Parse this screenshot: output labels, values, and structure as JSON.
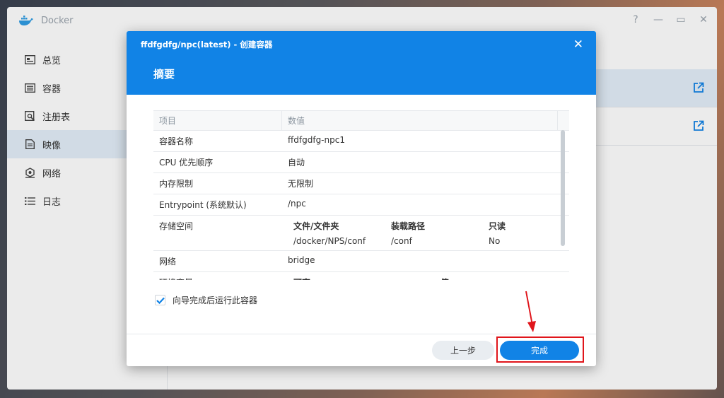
{
  "app": {
    "title": "Docker",
    "window_controls": [
      "?",
      "—",
      "▭",
      "✕"
    ]
  },
  "sidebar": {
    "items": [
      {
        "label": "总览",
        "icon": "overview-icon",
        "active": false
      },
      {
        "label": "容器",
        "icon": "container-icon",
        "active": false
      },
      {
        "label": "注册表",
        "icon": "registry-icon",
        "active": false
      },
      {
        "label": "映像",
        "icon": "image-icon",
        "active": true
      },
      {
        "label": "网络",
        "icon": "network-icon",
        "active": false
      },
      {
        "label": "日志",
        "icon": "log-icon",
        "active": false
      }
    ]
  },
  "dialog": {
    "title": "ffdfgdfg/npc(latest) - 创建容器",
    "heading": "摘要",
    "close": "✕",
    "table": {
      "headers": [
        "项目",
        "数值"
      ],
      "rows": [
        {
          "item": "容器名称",
          "value": "ffdfgdfg-npc1"
        },
        {
          "item": "CPU 优先顺序",
          "value": "自动"
        },
        {
          "item": "内存限制",
          "value": "无限制"
        },
        {
          "item": "Entrypoint (系统默认)",
          "value": "/npc"
        }
      ],
      "storage": {
        "item": "存储空间",
        "headers": [
          "文件/文件夹",
          "装载路径",
          "只读"
        ],
        "values": [
          "/docker/NPS/conf",
          "/conf",
          "No"
        ]
      },
      "network": {
        "item": "网络",
        "value": "bridge"
      },
      "env": {
        "item": "环境变量",
        "headers": [
          "可变",
          "值"
        ]
      }
    },
    "checkbox_label": "向导完成后运行此容器",
    "checkbox_checked": true,
    "buttons": {
      "back": "上一步",
      "finish": "完成"
    }
  },
  "colors": {
    "accent": "#1183e6",
    "highlight": "#e0151b"
  }
}
